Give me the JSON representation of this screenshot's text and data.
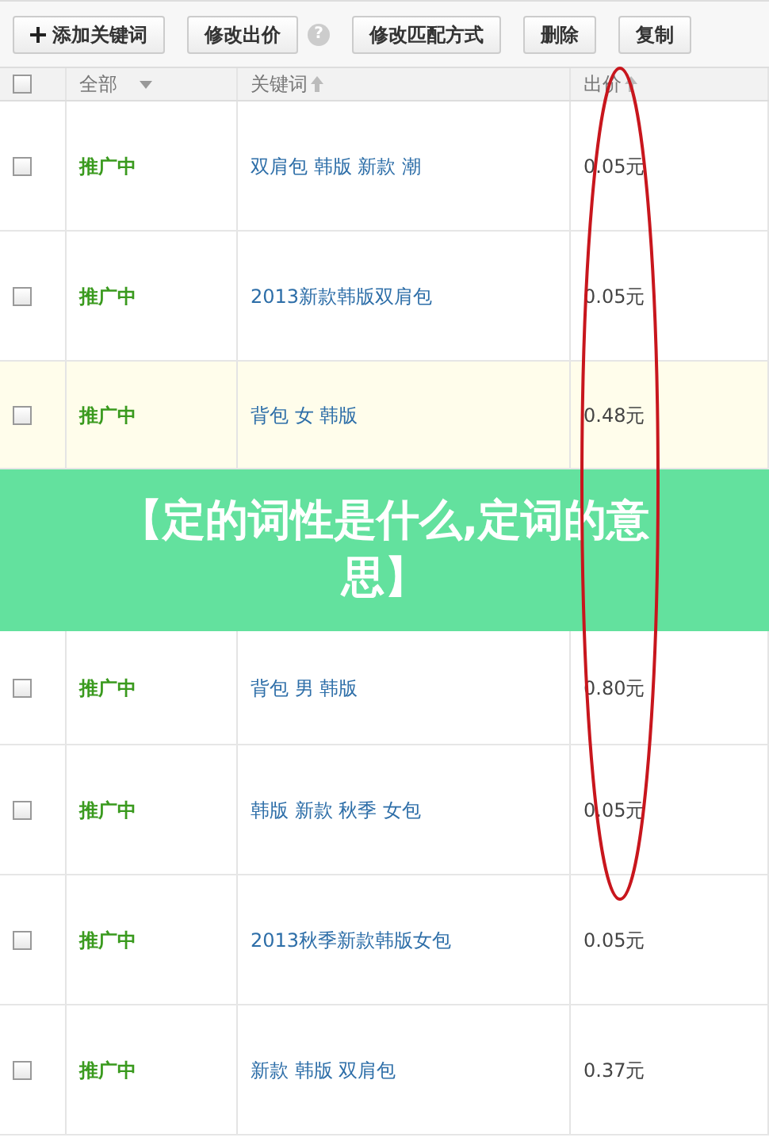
{
  "toolbar": {
    "buttons": [
      {
        "label": "添加关键词",
        "kind": "add"
      },
      {
        "label": "修改出价",
        "kind": "plain"
      },
      {
        "label": "?",
        "kind": "help"
      },
      {
        "label": "修改匹配方式",
        "kind": "plain"
      },
      {
        "label": "删除",
        "kind": "plain"
      },
      {
        "label": "复制",
        "kind": "plain"
      }
    ]
  },
  "table": {
    "columns": [
      {
        "kind": "checkbox",
        "checked": false
      },
      {
        "label": "全部",
        "kind": "dropdown"
      },
      {
        "label": "关键词",
        "kind": "sort"
      },
      {
        "label": "出价",
        "kind": "sort"
      }
    ],
    "rows": [
      {
        "checked": false,
        "status": "推广中",
        "keyword": "双肩包 韩版 新款 潮",
        "price": "0.05元",
        "highlighted": false
      },
      {
        "checked": false,
        "status": "推广中",
        "keyword": "2013新款韩版双肩包",
        "price": "0.05元",
        "highlighted": false
      },
      {
        "checked": false,
        "status": "推广中",
        "keyword": "背包 女 韩版",
        "price": "0.48元",
        "highlighted": true
      },
      {
        "kind": "banner",
        "title": "【定的词性是什么,定词的意思】"
      },
      {
        "checked": false,
        "status": "推广中",
        "keyword": "背包 男 韩版",
        "price": "0.80元",
        "highlighted": false
      },
      {
        "checked": false,
        "status": "推广中",
        "keyword": "韩版 新款 秋季 女包",
        "price": "0.05元",
        "highlighted": false
      },
      {
        "checked": false,
        "status": "推广中",
        "keyword": "2013秋季新款韩版女包",
        "price": "0.05元",
        "highlighted": false
      },
      {
        "checked": false,
        "status": "推广中",
        "keyword": "新款 韩版 双肩包",
        "price": "0.37元",
        "highlighted": false
      }
    ]
  }
}
